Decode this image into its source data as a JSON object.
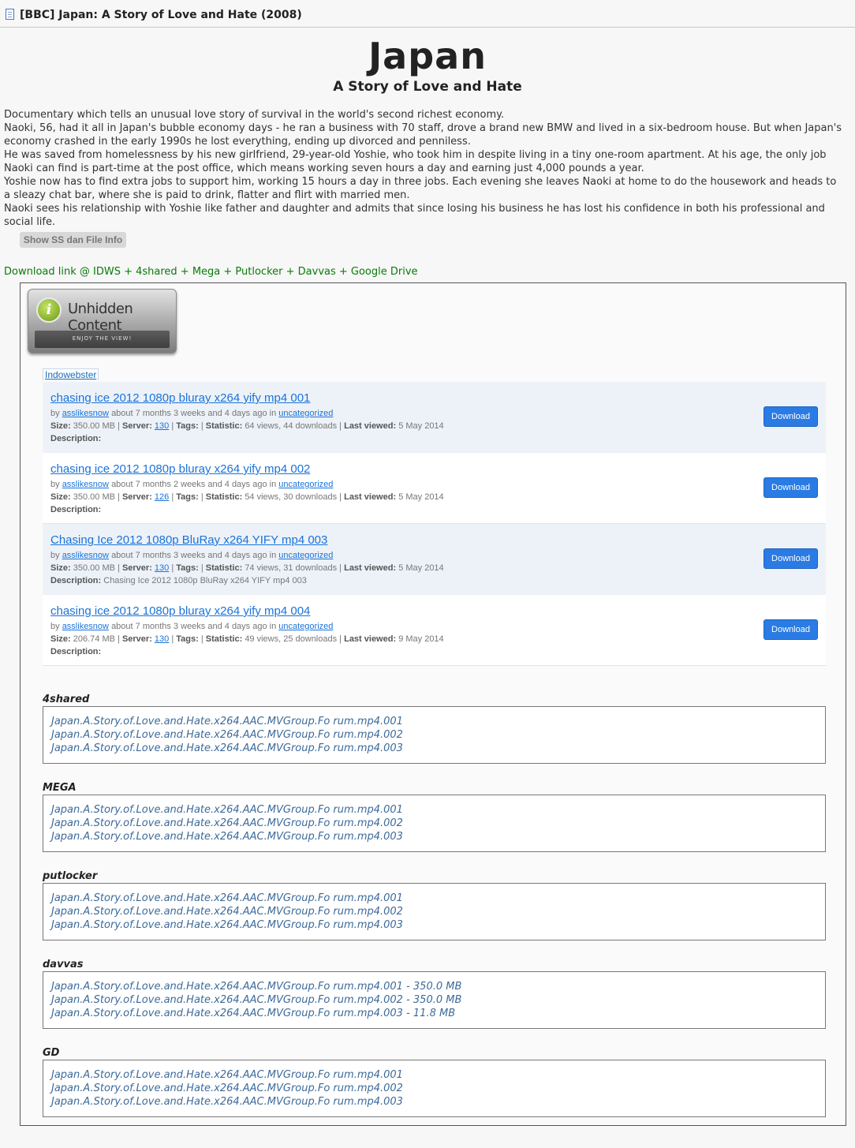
{
  "post_title": "[BBC] Japan: A Story of Love and Hate (2008)",
  "heading": "Japan",
  "subheading": "A Story of Love and Hate",
  "description_lines": [
    "Documentary which tells an unusual love story of survival in the world's second richest economy.",
    "Naoki, 56, had it all in Japan's bubble economy days - he ran a business with 70 staff, drove a brand new BMW and lived in a six-bedroom house. But when Japan's",
    "economy crashed in the early 1990s he lost everything, ending up divorced and penniless.",
    "He was saved from homelessness by his new girlfriend, 29-year-old Yoshie, who took him in despite living in a tiny one-room apartment. At his age, the only job",
    "Naoki can find is part-time at the post office, which means working seven hours a day and earning just 4,000 pounds a year.",
    "Yoshie now has to find extra jobs to support him, working 15 hours a day in three jobs. Each evening she leaves Naoki at home to do the housework and heads to",
    "a sleazy chat bar, where she is paid to drink, flatter and flirt with married men.",
    "Naoki sees his relationship with Yoshie like father and daughter and admits that since losing his business he has lost his confidence in both his professional and",
    "social life."
  ],
  "show_button": "Show SS dan File Info",
  "download_header": "Download link @ IDWS + 4shared + Mega + Putlocker + Davvas + Google Drive",
  "badge": {
    "icon_letter": "i",
    "title": "Unhidden Content",
    "tagline": "ENJOY THE VIEW!"
  },
  "indowebster_tab": "Indowebster",
  "labels": {
    "by": "by",
    "in": "in",
    "size": "Size:",
    "server": "Server:",
    "tags": "Tags:",
    "statistic": "Statistic:",
    "last_viewed": "Last viewed:",
    "description": "Description:",
    "sep": "|"
  },
  "files": [
    {
      "title": "chasing ice 2012 1080p bluray x264 yify mp4 001",
      "user": "asslikesnow",
      "ago": "about 7 months 3 weeks and 4 days ago",
      "category": "uncategorized",
      "size": "350.00 MB",
      "server": "130",
      "stats": "64 views, 44 downloads",
      "last_viewed": "5 May 2014",
      "description": "",
      "button": "Download"
    },
    {
      "title": "chasing ice 2012 1080p bluray x264 yify mp4 002",
      "user": "asslikesnow",
      "ago": "about 7 months 2 weeks and 4 days ago",
      "category": "uncategorized",
      "size": "350.00 MB",
      "server": "126",
      "stats": "54 views, 30 downloads",
      "last_viewed": "5 May 2014",
      "description": "",
      "button": "Download"
    },
    {
      "title": "Chasing Ice 2012 1080p BluRay x264 YIFY mp4 003",
      "user": "asslikesnow",
      "ago": "about 7 months 3 weeks and 4 days ago",
      "category": "uncategorized",
      "size": "350.00 MB",
      "server": "130",
      "stats": "74 views, 31 downloads",
      "last_viewed": "5 May 2014",
      "description": "Chasing Ice 2012 1080p BluRay x264 YIFY mp4 003",
      "button": "Download"
    },
    {
      "title": "chasing ice 2012 1080p bluray x264 yify mp4 004",
      "user": "asslikesnow",
      "ago": "about 7 months 3 weeks and 4 days ago",
      "category": "uncategorized",
      "size": "206.74 MB",
      "server": "130",
      "stats": "49 views, 25 downloads",
      "last_viewed": "9 May 2014",
      "description": "",
      "button": "Download"
    }
  ],
  "hosts": [
    {
      "name": "4shared",
      "links": [
        "Japan.A.Story.of.Love.and.Hate.x264.AAC.MVGroup.Fo rum.mp4.001",
        "Japan.A.Story.of.Love.and.Hate.x264.AAC.MVGroup.Fo rum.mp4.002",
        "Japan.A.Story.of.Love.and.Hate.x264.AAC.MVGroup.Fo rum.mp4.003"
      ]
    },
    {
      "name": "MEGA",
      "links": [
        "Japan.A.Story.of.Love.and.Hate.x264.AAC.MVGroup.Fo rum.mp4.001",
        "Japan.A.Story.of.Love.and.Hate.x264.AAC.MVGroup.Fo rum.mp4.002",
        "Japan.A.Story.of.Love.and.Hate.x264.AAC.MVGroup.Fo rum.mp4.003"
      ]
    },
    {
      "name": "putlocker",
      "links": [
        "Japan.A.Story.of.Love.and.Hate.x264.AAC.MVGroup.Fo rum.mp4.001",
        "Japan.A.Story.of.Love.and.Hate.x264.AAC.MVGroup.Fo rum.mp4.002",
        "Japan.A.Story.of.Love.and.Hate.x264.AAC.MVGroup.Fo rum.mp4.003"
      ]
    },
    {
      "name": "davvas",
      "links": [
        "Japan.A.Story.of.Love.and.Hate.x264.AAC.MVGroup.Fo rum.mp4.001 - 350.0 MB",
        "Japan.A.Story.of.Love.and.Hate.x264.AAC.MVGroup.Fo rum.mp4.002 - 350.0 MB",
        "Japan.A.Story.of.Love.and.Hate.x264.AAC.MVGroup.Fo rum.mp4.003 - 11.8 MB"
      ]
    },
    {
      "name": "GD",
      "links": [
        "Japan.A.Story.of.Love.and.Hate.x264.AAC.MVGroup.Fo rum.mp4.001",
        "Japan.A.Story.of.Love.and.Hate.x264.AAC.MVGroup.Fo rum.mp4.002",
        "Japan.A.Story.of.Love.and.Hate.x264.AAC.MVGroup.Fo rum.mp4.003"
      ]
    }
  ]
}
